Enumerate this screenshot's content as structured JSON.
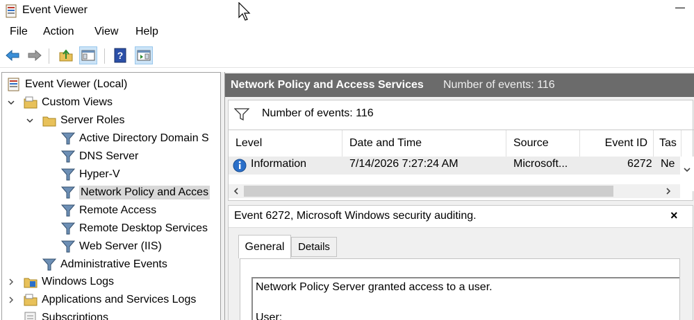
{
  "window": {
    "title": "Event Viewer"
  },
  "menu": [
    "File",
    "Action",
    "View",
    "Help"
  ],
  "tree": {
    "root": "Event Viewer (Local)",
    "custom_views": "Custom Views",
    "server_roles": "Server Roles",
    "views": [
      "Active Directory Domain S",
      "DNS Server",
      "Hyper-V",
      "Network Policy and Acces",
      "Remote Access",
      "Remote Desktop Services",
      "Web Server (IIS)"
    ],
    "administrative_events": "Administrative Events",
    "windows_logs": "Windows Logs",
    "apps_services_logs": "Applications and Services Logs",
    "subscriptions": "Subscriptions"
  },
  "header": {
    "title": "Network Policy and Access Services",
    "count": "Number of events: 116"
  },
  "filter": {
    "label": "Number of events: 116"
  },
  "grid": {
    "columns": [
      "Level",
      "Date and Time",
      "Source",
      "Event ID",
      "Tas"
    ],
    "rows": [
      {
        "level": "Information",
        "datetime": "7/14/2026 7:27:24 AM",
        "source": "Microsoft...",
        "event_id": "6272",
        "task": "Ne"
      }
    ]
  },
  "detail": {
    "title": "Event 6272, Microsoft Windows security auditing.",
    "close": "×",
    "tabs": [
      "General",
      "Details"
    ],
    "description": "Network Policy Server granted access to a user.",
    "user_label": "User:"
  },
  "colors": {
    "header_bg": "#6b6b6b",
    "selection": "#d9d9d9",
    "info_icon": "#2a6fc9",
    "folder": "#e8c15a"
  }
}
